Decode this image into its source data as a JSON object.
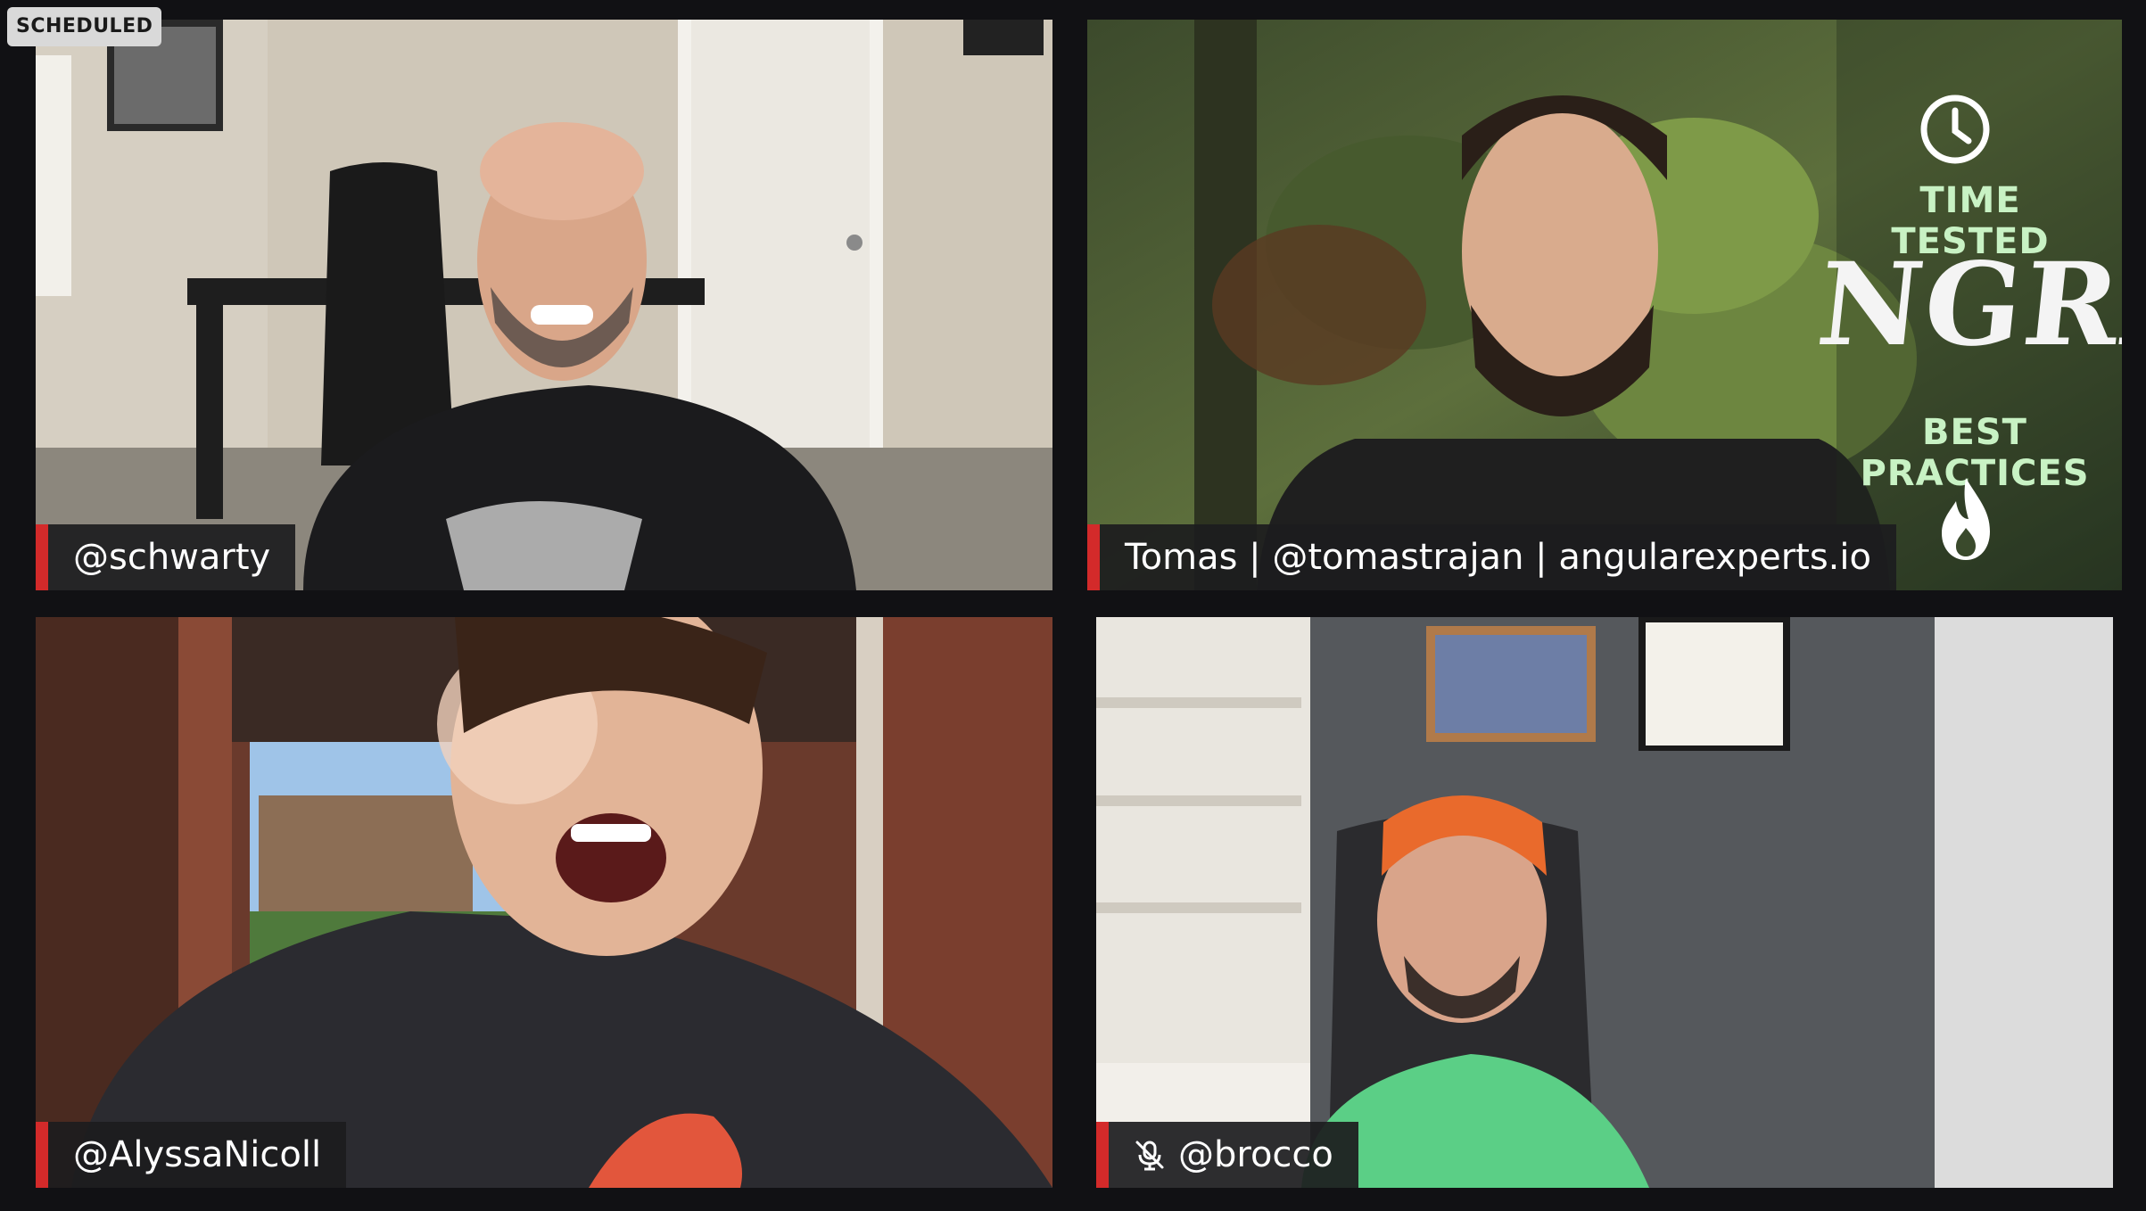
{
  "status_badge": "SCHEDULED",
  "participants": [
    {
      "name": "@schwarty",
      "muted": false
    },
    {
      "name": "Tomas | @tomastrajan | angularexperts.io",
      "muted": false
    },
    {
      "name": "@AlyssaNicoll",
      "muted": false
    },
    {
      "name": "@brocco",
      "muted": true
    }
  ],
  "overlay": {
    "line1": "TIME TESTED",
    "line2": "NGRX",
    "line3": "BEST PRACTICES"
  },
  "colors": {
    "nameplate_accent": "#d32a2a",
    "overlay_text": "#c8f2c4",
    "background": "#111114"
  },
  "icons": [
    "clock-icon",
    "flame-icon",
    "mic-off-icon"
  ]
}
